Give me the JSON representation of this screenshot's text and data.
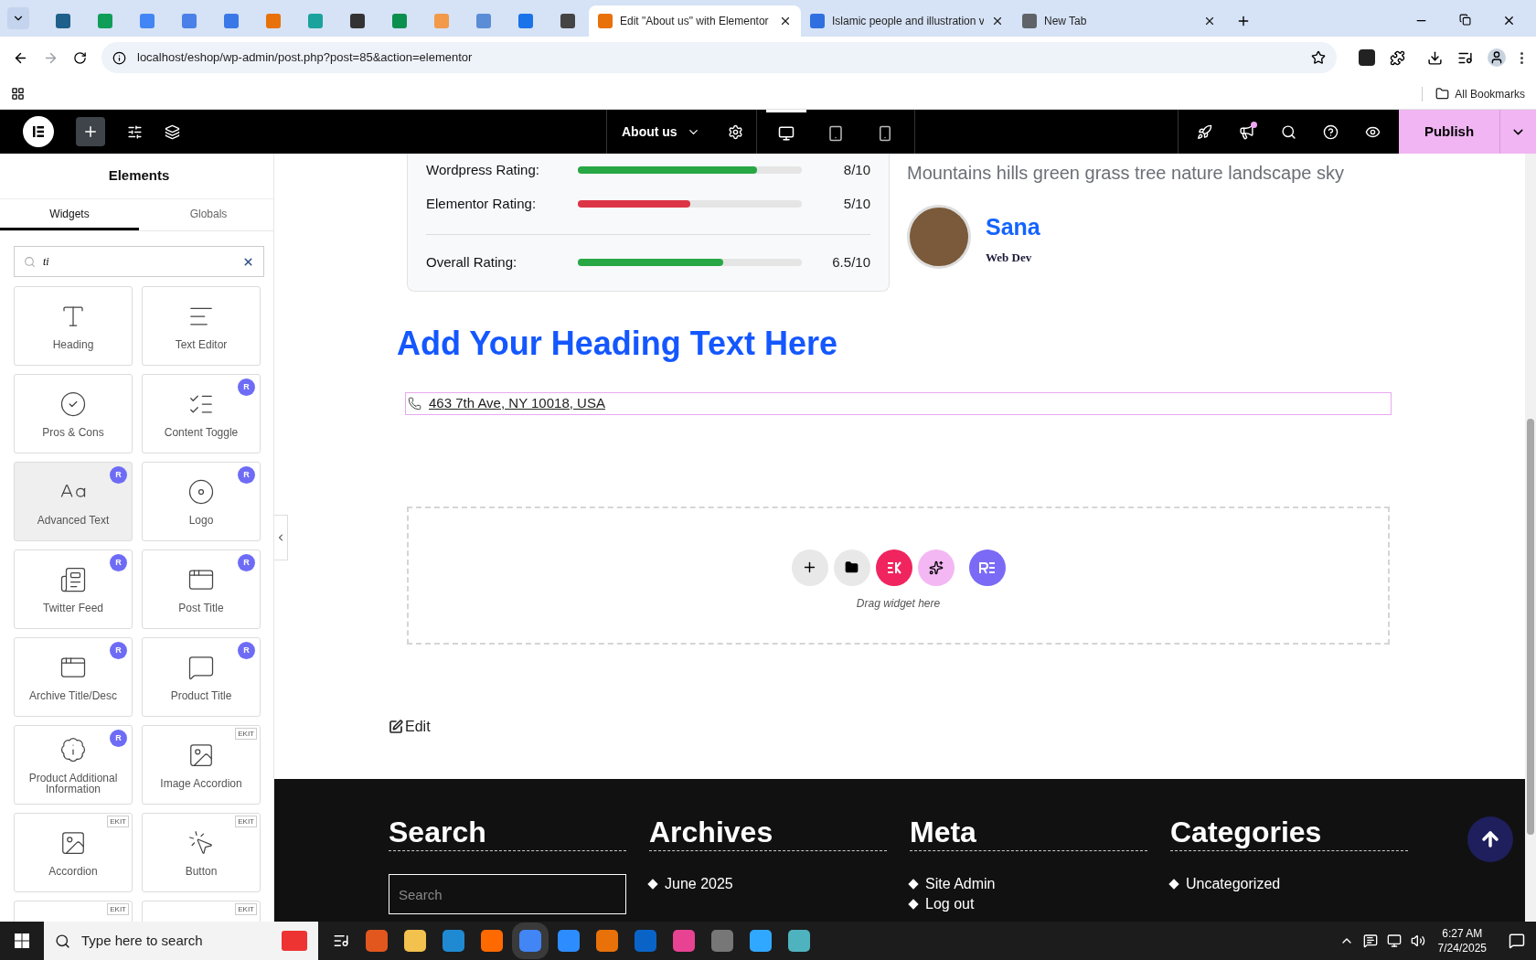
{
  "browser": {
    "tabs": [
      {
        "kind": "icon",
        "selected": false,
        "color": "#1f5f8b"
      },
      {
        "kind": "icon",
        "selected": false,
        "color": "#0f9d58"
      },
      {
        "kind": "icon",
        "selected": false,
        "color": "#4285f4"
      },
      {
        "kind": "icon",
        "selected": false,
        "color": "#4a80e8"
      },
      {
        "kind": "icon",
        "selected": false,
        "color": "#3b78e7"
      },
      {
        "kind": "icon",
        "selected": false,
        "color": "#e8710a"
      },
      {
        "kind": "icon",
        "selected": false,
        "color": "#1aa39c"
      },
      {
        "kind": "icon",
        "selected": false,
        "color": "#333333"
      },
      {
        "kind": "icon",
        "selected": false,
        "color": "#0b8f4f"
      },
      {
        "kind": "icon",
        "selected": false,
        "color": "#f2994a"
      },
      {
        "kind": "icon",
        "selected": false,
        "color": "#5b8dd6"
      },
      {
        "kind": "icon",
        "selected": false,
        "color": "#1a73e8"
      },
      {
        "kind": "icon",
        "selected": false,
        "color": "#444444"
      },
      {
        "kind": "titled",
        "title": "Edit \"About us\" with Elementor",
        "selected": true,
        "color": "#e8710a"
      },
      {
        "kind": "titled",
        "title": "Islamic people and illustration v",
        "selected": false,
        "color": "#2f6fe0"
      },
      {
        "kind": "titled",
        "title": "New Tab",
        "selected": false,
        "color": "#5f6368"
      }
    ],
    "address": "localhost/eshop/wp-admin/post.php?post=85&action=elementor",
    "bookmarks_label": "All Bookmarks"
  },
  "editor": {
    "add_selected": true,
    "page_title": "About us",
    "devices": [
      {
        "selected": true
      },
      {
        "selected": false
      },
      {
        "selected": false
      }
    ],
    "publish": "Publish"
  },
  "panel": {
    "title": "Elements",
    "tabs": [
      {
        "label": "Widgets",
        "selected": true
      },
      {
        "label": "Globals",
        "selected": false
      }
    ],
    "search": {
      "value": "ti"
    },
    "widgets": [
      {
        "label": "Heading",
        "selected": false
      },
      {
        "label": "Text Editor",
        "selected": false
      },
      {
        "label": "Pros & Cons",
        "selected": false
      },
      {
        "label": "Content Toggle",
        "selected": false,
        "badge": {
          "kind": "circle",
          "text": "R"
        }
      },
      {
        "label": "Advanced Text",
        "selected": true,
        "badge": {
          "kind": "circle",
          "text": "R"
        }
      },
      {
        "label": "Logo",
        "selected": false,
        "badge": {
          "kind": "circle",
          "text": "R"
        }
      },
      {
        "label": "Twitter Feed",
        "selected": false,
        "badge": {
          "kind": "circle",
          "text": "R"
        }
      },
      {
        "label": "Post Title",
        "selected": false,
        "badge": {
          "kind": "circle",
          "text": "R"
        }
      },
      {
        "label": "Archive Title/Desc",
        "selected": false,
        "badge": {
          "kind": "circle",
          "text": "R"
        }
      },
      {
        "label": "Product Title",
        "selected": false,
        "badge": {
          "kind": "circle",
          "text": "R"
        }
      },
      {
        "label": "Product Additional Information",
        "selected": false,
        "badge": {
          "kind": "circle",
          "text": "R"
        }
      },
      {
        "label": "Image Accordion",
        "selected": false,
        "badge": {
          "kind": "tag",
          "text": "EKIT"
        }
      },
      {
        "label": "Accordion",
        "selected": false,
        "badge": {
          "kind": "tag",
          "text": "EKIT"
        }
      },
      {
        "label": "Button",
        "selected": false,
        "badge": {
          "kind": "tag",
          "text": "EKIT"
        }
      },
      {
        "selected": false,
        "badge": {
          "kind": "tag",
          "text": "EKIT"
        }
      },
      {
        "selected": false,
        "badge": {
          "kind": "tag",
          "text": "EKIT"
        }
      }
    ]
  },
  "canvas": {
    "ratings": {
      "rows": [
        {
          "label": "Wordpress Rating:",
          "level": 0.8,
          "reading": "8/10",
          "color": "#28a745"
        },
        {
          "label": "Elementor Rating:",
          "level": 0.5,
          "reading": "5/10",
          "color": "#dc3545"
        }
      ],
      "overall": {
        "label": "Overall Rating:",
        "level": 0.65,
        "reading": "6.5/10",
        "color": "#28a745"
      }
    },
    "testimonial": {
      "caption": "Mountains hills green grass tree nature landscape sky",
      "name": "Sana",
      "role": "Web Dev"
    },
    "heading": "Add Your Heading Text Here",
    "address": "463 7th Ave, NY 10018, USA",
    "dropzone_hint": "Drag widget here",
    "edit_link": "Edit",
    "footer": {
      "columns": [
        {
          "kind": "search",
          "title": "Search",
          "placeholder": "Search"
        },
        {
          "kind": "list",
          "title": "Archives",
          "items": [
            "June 2025"
          ]
        },
        {
          "kind": "list",
          "title": "Meta",
          "items": [
            "Site Admin",
            "Log out"
          ]
        },
        {
          "kind": "list",
          "title": "Categories",
          "items": [
            "Uncategorized"
          ]
        }
      ]
    }
  },
  "taskbar": {
    "search_placeholder": "Type here to search",
    "time": "6:27 AM",
    "date": "7/24/2025"
  }
}
